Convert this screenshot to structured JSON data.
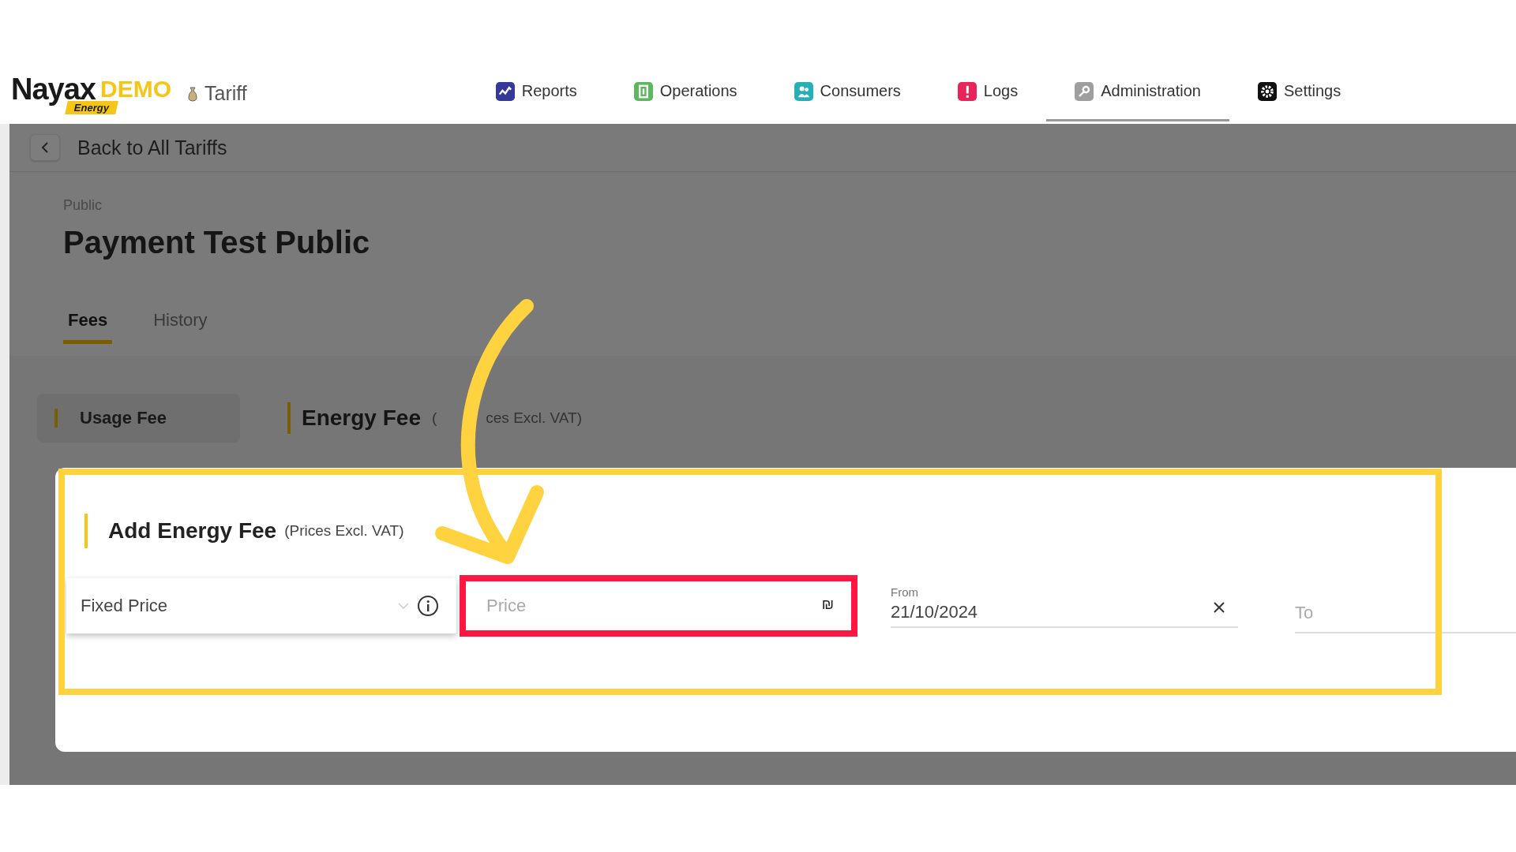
{
  "header": {
    "logo": {
      "brand": "Nayax",
      "badge": "DEMO",
      "sub": "Energy"
    },
    "section": "Tariff",
    "nav": [
      {
        "label": "Reports",
        "kind": "chart",
        "color": "#35399a",
        "selected": false
      },
      {
        "label": "Operations",
        "kind": "panel",
        "color": "#5cb85c",
        "selected": false
      },
      {
        "label": "Consumers",
        "kind": "users",
        "color": "#26b0b5",
        "selected": false
      },
      {
        "label": "Logs",
        "kind": "alert",
        "color": "#e8245a",
        "selected": false
      },
      {
        "label": "Administration",
        "kind": "key",
        "color": "#9e9e9e",
        "selected": true
      },
      {
        "label": "Settings",
        "kind": "gear",
        "color": "#111111",
        "selected": false
      }
    ]
  },
  "back": {
    "label": "Back to All Tariffs"
  },
  "tariff": {
    "type": "Public",
    "title": "Payment Test Public"
  },
  "tabs": [
    {
      "label": "Fees",
      "selected": true
    },
    {
      "label": "History",
      "selected": false
    }
  ],
  "fee_menu": [
    {
      "label": "Usage Fee",
      "selected": true
    }
  ],
  "section": {
    "title": "Energy Fee",
    "note_start": "(",
    "note_end": "ces Excl. VAT)"
  },
  "modal": {
    "title": "Add Energy Fee",
    "note": "(Prices Excl. VAT)",
    "pricing": {
      "value": "Fixed Price"
    },
    "price": {
      "placeholder": "Price",
      "currency": "₪"
    },
    "from": {
      "label": "From",
      "value": "21/10/2024"
    },
    "to": {
      "placeholder": "To"
    }
  }
}
